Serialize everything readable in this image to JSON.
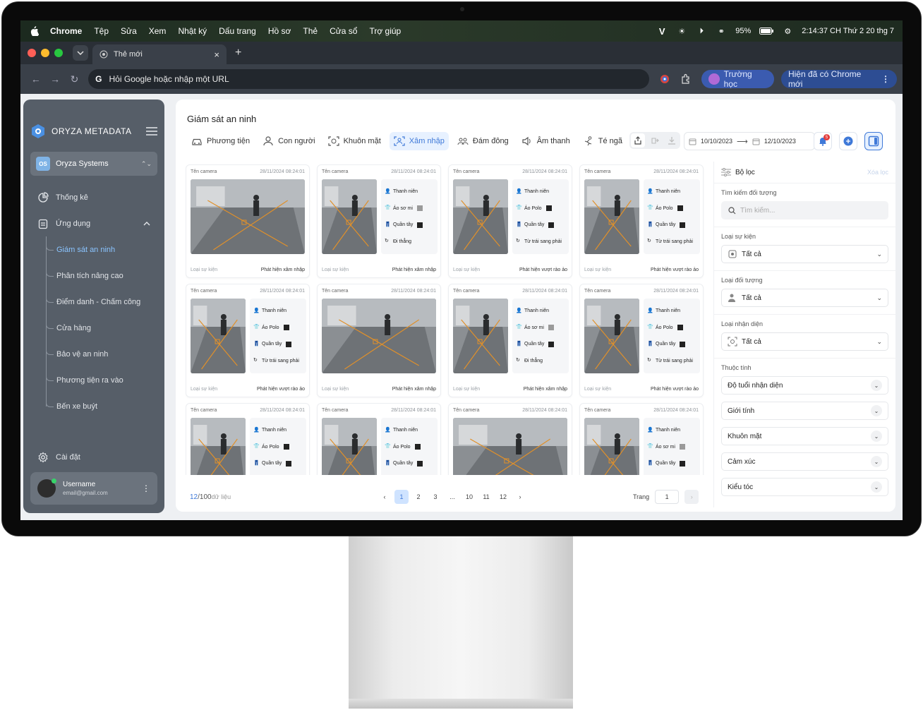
{
  "menubar": {
    "items": [
      "Chrome",
      "Tệp",
      "Sửa",
      "Xem",
      "Nhật ký",
      "Dấu trang",
      "Hồ sơ",
      "Thẻ",
      "Cửa sổ",
      "Trợ giúp"
    ],
    "battery": "95%",
    "clock": "2:14:37 CH Thứ 2 20 thg 7"
  },
  "browser": {
    "tab_title": "Thẻ mới",
    "omnibox_placeholder": "Hỏi Google hoặc nhập một URL",
    "profile_label": "Trường học",
    "update_label": "Hiện đã có Chrome mới"
  },
  "sidebar": {
    "brand": "ORYZA METADATA",
    "org_badge": "OS",
    "org_name": "Oryza Systems",
    "stats_label": "Thống kê",
    "apps_label": "Ứng dụng",
    "sub_items": [
      "Giám sát an ninh",
      "Phân tích nâng cao",
      "Điểm danh - Chấm công",
      "Cửa hàng",
      "Bảo vệ an ninh",
      "Phương tiện ra vào",
      "Bến xe buýt"
    ],
    "settings_label": "Cài đặt",
    "username": "Username",
    "email": "email@gmail.com"
  },
  "main": {
    "title": "Giám sát an ninh",
    "tabs": [
      "Phương tiện",
      "Con người",
      "Khuôn mặt",
      "Xâm nhập",
      "Đám đông",
      "Âm thanh",
      "Té ngã"
    ],
    "date_from": "10/10/2023",
    "date_to": "12/10/2023",
    "notif_count": "5"
  },
  "cards": [
    {
      "camera": "Tên camera",
      "time": "28/11/2024  08:24:01",
      "layout": "wide",
      "event_label": "Loại sự kiện",
      "event": "Phát hiện xâm nhập",
      "attrs": []
    },
    {
      "camera": "Tên camera",
      "time": "28/11/2024  08:24:01",
      "layout": "small",
      "event_label": "Loại sự kiện",
      "event": "Phát hiện xâm nhập",
      "attrs": [
        "Thanh niên",
        "Áo sơ mi",
        "Quần tây",
        "Đi thẳng"
      ]
    },
    {
      "camera": "Tên camera",
      "time": "28/11/2024  08:24:01",
      "layout": "small",
      "event_label": "Loại sự kiện",
      "event": "Phát hiện vượt rào ảo",
      "attrs": [
        "Thanh niên",
        "Áo Polo",
        "Quần tây",
        "Từ trái sang phải"
      ]
    },
    {
      "camera": "Tên camera",
      "time": "28/11/2024  08:24:01",
      "layout": "small",
      "event_label": "Loại sự kiện",
      "event": "Phát hiện vượt rào ảo",
      "attrs": [
        "Thanh niên",
        "Áo Polo",
        "Quần tây",
        "Từ trái sang phải"
      ]
    },
    {
      "camera": "Tên camera",
      "time": "28/11/2024  08:24:01",
      "layout": "small",
      "event_label": "Loại sự kiện",
      "event": "Phát hiện vượt rào ảo",
      "attrs": [
        "Thanh niên",
        "Áo Polo",
        "Quần tây",
        "Từ trái sang phải"
      ]
    },
    {
      "camera": "Tên camera",
      "time": "28/11/2024  08:24:01",
      "layout": "wide",
      "event_label": "Loại sự kiện",
      "event": "Phát hiện xâm nhập",
      "attrs": []
    },
    {
      "camera": "Tên camera",
      "time": "28/11/2024  08:24:01",
      "layout": "small",
      "event_label": "Loại sự kiện",
      "event": "Phát hiện xâm nhập",
      "attrs": [
        "Thanh niên",
        "Áo sơ mi",
        "Quần tây",
        "Đi thẳng"
      ]
    },
    {
      "camera": "Tên camera",
      "time": "28/11/2024  08:24:01",
      "layout": "small",
      "event_label": "Loại sự kiện",
      "event": "Phát hiện vượt rào ảo",
      "attrs": [
        "Thanh niên",
        "Áo Polo",
        "Quần tây",
        "Từ trái sang phải"
      ]
    },
    {
      "camera": "Tên camera",
      "time": "28/11/2024  08:24:01",
      "layout": "small",
      "event_label": "",
      "event": "",
      "attrs": [
        "Thanh niên",
        "Áo Polo",
        "Quần tây"
      ]
    },
    {
      "camera": "Tên camera",
      "time": "28/11/2024  08:24:01",
      "layout": "small",
      "event_label": "",
      "event": "",
      "attrs": [
        "Thanh niên",
        "Áo Polo",
        "Quần tây"
      ]
    },
    {
      "camera": "Tên camera",
      "time": "28/11/2024  08:24:01",
      "layout": "wide",
      "event_label": "",
      "event": "",
      "attrs": []
    },
    {
      "camera": "Tên camera",
      "time": "28/11/2024  08:24:01",
      "layout": "small",
      "event_label": "",
      "event": "",
      "attrs": [
        "Thanh niên",
        "Áo sơ mi",
        "Quần tây"
      ]
    }
  ],
  "pager": {
    "current": "12",
    "total": "/100",
    "unit": " dữ liệu",
    "pages": [
      "1",
      "2",
      "3",
      "...",
      "10",
      "11",
      "12"
    ],
    "goto_label": "Trang",
    "goto_value": "1"
  },
  "filter": {
    "title": "Bộ lọc",
    "clear": "Xóa lọc",
    "search_label": "Tìm kiếm đối tượng",
    "search_placeholder": "Tìm kiếm...",
    "event_type_label": "Loại sự kiện",
    "event_type_value": "Tất cả",
    "object_type_label": "Loại đối tượng",
    "object_type_value": "Tất cả",
    "recog_type_label": "Loại nhận diện",
    "recog_type_value": "Tất cả",
    "attr_label": "Thuộc tính",
    "accordions": [
      "Độ tuổi nhận diện",
      "Giới tính",
      "Khuôn mặt",
      "Cảm xúc",
      "Kiểu tóc"
    ]
  },
  "colors": {
    "accent": "#3f79d8",
    "sidebar": "#565e68",
    "active_tab_bg": "#e7f1ff"
  }
}
